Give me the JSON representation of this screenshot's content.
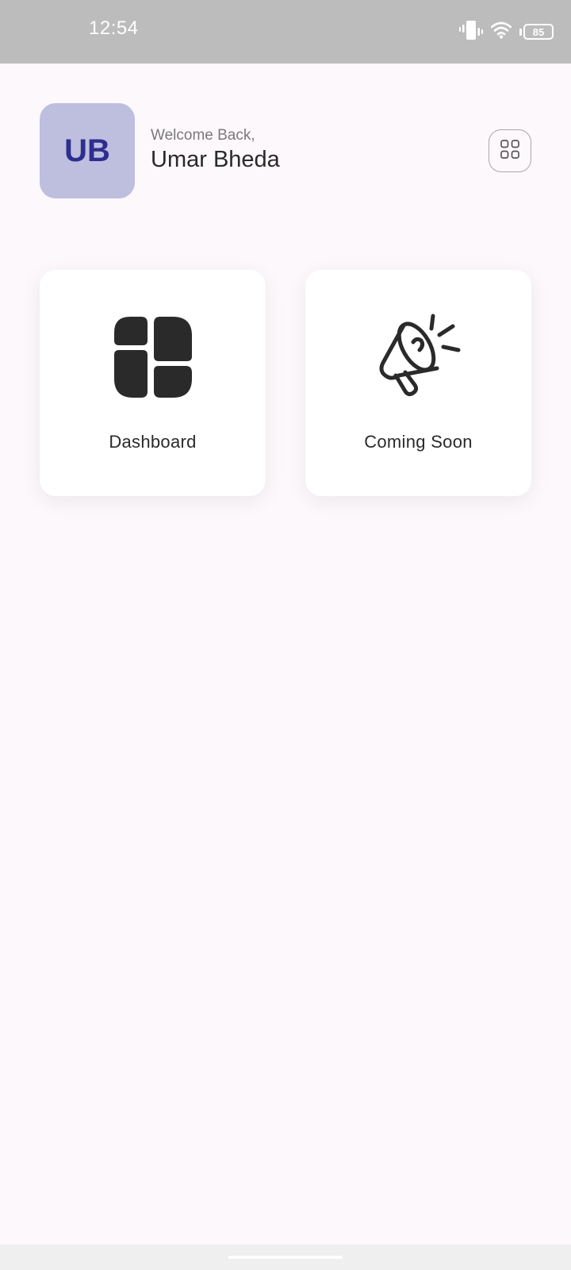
{
  "status_bar": {
    "time": "12:54",
    "battery_level": "85",
    "icons": [
      "vibrate-icon",
      "wifi-icon",
      "battery-icon"
    ]
  },
  "header": {
    "avatar_initials": "UB",
    "greeting": "Welcome Back,",
    "user_name": "Umar Bheda",
    "menu_icon": "grid-icon"
  },
  "cards": [
    {
      "label": "Dashboard",
      "icon": "dashboard-icon"
    },
    {
      "label": "Coming Soon",
      "icon": "megaphone-icon"
    }
  ],
  "colors": {
    "background": "#fdf8fc",
    "status_bar": "#bdbcbd",
    "avatar_bg": "#bebedf",
    "avatar_text": "#2e2e8f",
    "card_bg": "#ffffff",
    "text_primary": "#2a2a2a",
    "text_secondary": "#7a7a7a"
  }
}
